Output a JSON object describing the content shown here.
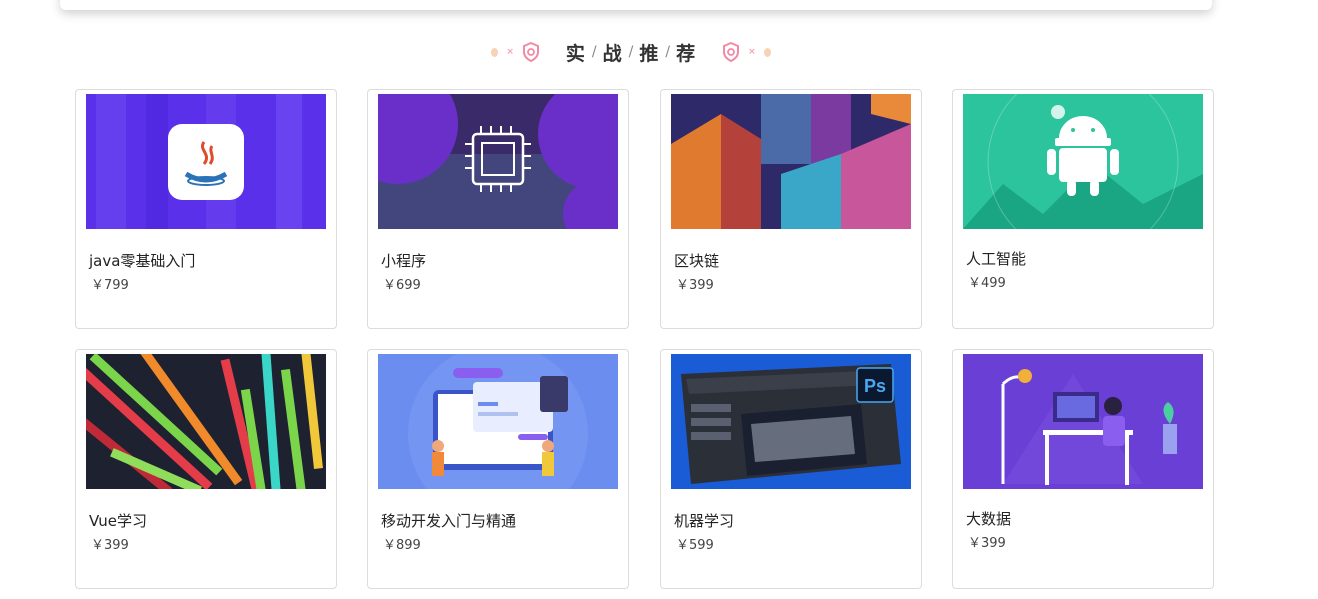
{
  "section": {
    "title_chars": [
      "实",
      "战",
      "推",
      "荐"
    ],
    "separator": "/"
  },
  "courses": [
    {
      "name": "java零基础入门",
      "price": "￥799",
      "thumb": "java-cup-icon",
      "color": "#5b2ee8"
    },
    {
      "name": "小程序",
      "price": "￥699",
      "thumb": "chip-icon",
      "color": "#6a2fc8"
    },
    {
      "name": "区块链",
      "price": "￥399",
      "thumb": "blocks-image",
      "color": "#3b2a88"
    },
    {
      "name": "人工智能",
      "price": "￥499",
      "thumb": "android-icon",
      "color": "#27c09a"
    },
    {
      "name": "Vue学习",
      "price": "￥399",
      "thumb": "bars-image",
      "color": "#1e2230"
    },
    {
      "name": "移动开发入门与精通",
      "price": "￥899",
      "thumb": "team-illustration",
      "color": "#6b8df0"
    },
    {
      "name": "机器学习",
      "price": "￥599",
      "thumb": "photoshop-screen-image",
      "color": "#1a5bd6"
    },
    {
      "name": "大数据",
      "price": "￥399",
      "thumb": "desk-illustration",
      "color": "#6a3fd6"
    }
  ]
}
